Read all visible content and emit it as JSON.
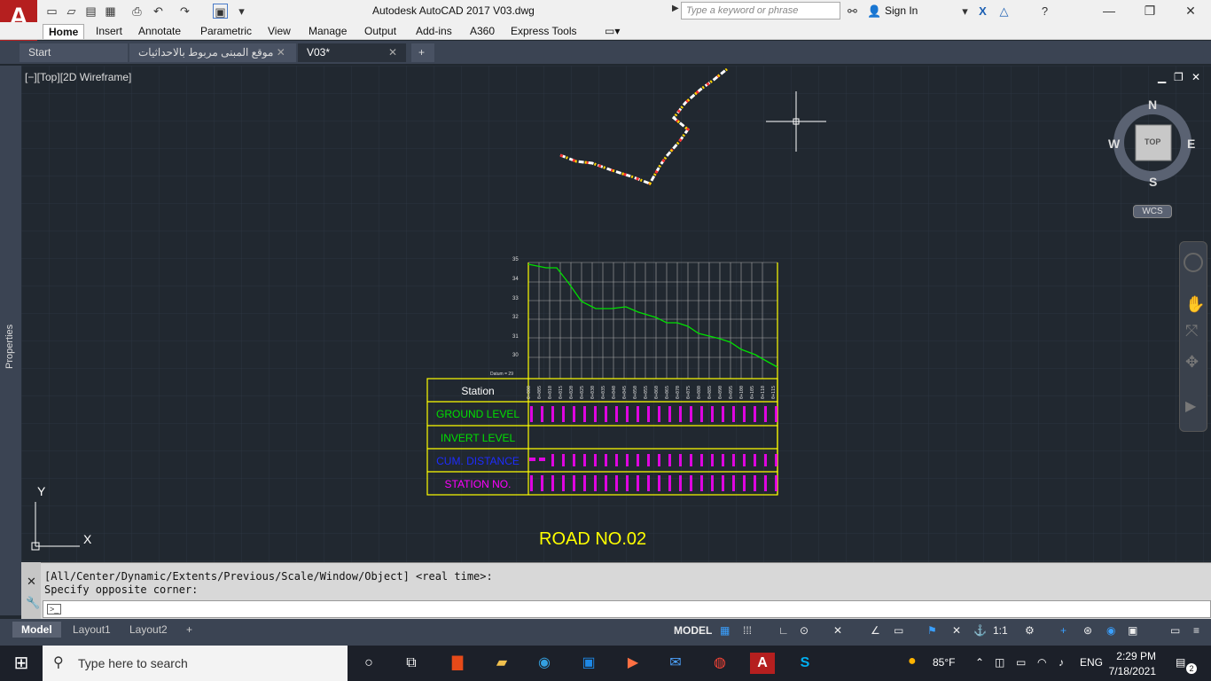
{
  "app": {
    "title": "Autodesk AutoCAD 2017    V03.dwg",
    "logo_letter": "A",
    "search_placeholder": "Type a keyword or phrase",
    "signin_label": "Sign In"
  },
  "ribbon_tabs": [
    "Home",
    "Insert",
    "Annotate",
    "Parametric",
    "View",
    "Manage",
    "Output",
    "Add-ins",
    "A360",
    "Express Tools"
  ],
  "file_tabs": [
    {
      "label": "Start"
    },
    {
      "label": "موقع المبنى مربوط بالاحداثيات"
    },
    {
      "label": "V03*"
    }
  ],
  "viewport": {
    "label": "[−][Top][2D Wireframe]",
    "side_panel_label": "Properties"
  },
  "navcube": {
    "n": "N",
    "s": "S",
    "e": "E",
    "w": "W",
    "face": "TOP",
    "wcs": "WCS"
  },
  "drawing": {
    "road_title": "ROAD NO.02",
    "datum_label": "Datum = 29",
    "y_ticks": [
      "35",
      "34",
      "33",
      "32",
      "31",
      "30"
    ],
    "table_rows": [
      "Station",
      "GROUND LEVEL",
      "INVERT LEVEL",
      "CUM. DISTANCE",
      "STATION NO."
    ],
    "ucs": {
      "x": "X",
      "y": "Y"
    }
  },
  "command": {
    "line1": "[All/Center/Dynamic/Extents/Previous/Scale/Window/Object] <real time>:",
    "line2": "Specify opposite corner:",
    "prompt_icon": ">_"
  },
  "layout_tabs": [
    "Model",
    "Layout1",
    "Layout2"
  ],
  "status": {
    "model": "MODEL",
    "scale": "1:1"
  },
  "taskbar": {
    "search_placeholder": "Type here to search",
    "weather": "85°F",
    "lang": "ENG",
    "time": "2:29 PM",
    "date": "7/18/2021",
    "notifications": "2"
  },
  "colors": {
    "canvas": "#212830",
    "grid_yellow": "#ffff00",
    "profile_green": "#00e000",
    "label_magenta": "#ff00ff",
    "label_blue": "#1e2cff"
  }
}
